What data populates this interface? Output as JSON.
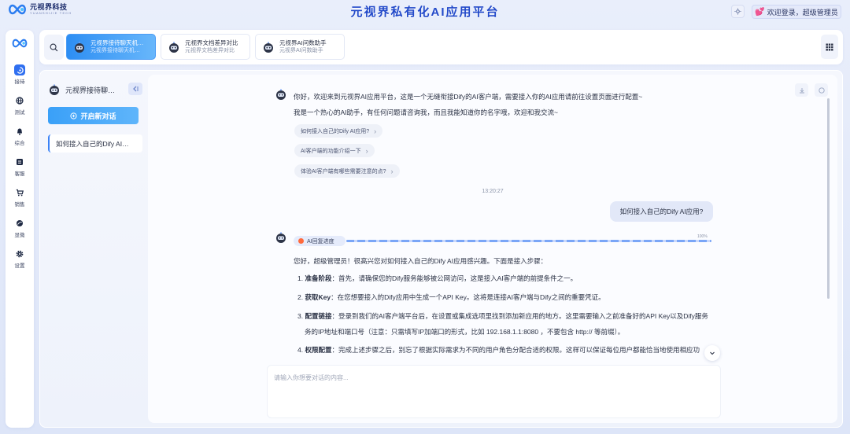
{
  "header": {
    "logo_cn": "元视界科技",
    "logo_en": "YUANSHIJIE TECH",
    "app_title": "元视界私有化AI应用平台",
    "user_greeting": "欢迎登录，超级管理员"
  },
  "rail": {
    "items": [
      {
        "label": "接待",
        "icon": "reception-icon",
        "active": true
      },
      {
        "label": "测试",
        "icon": "globe-icon",
        "active": false
      },
      {
        "label": "综合",
        "icon": "bell-icon",
        "active": false
      },
      {
        "label": "客服",
        "icon": "list-icon",
        "active": false
      },
      {
        "label": "销售",
        "icon": "cart-icon",
        "active": false
      },
      {
        "label": "显微",
        "icon": "planet-icon",
        "active": false
      },
      {
        "label": "设置",
        "icon": "gear-icon",
        "active": false
      }
    ]
  },
  "tabs": [
    {
      "title": "元视界接待聊天机…",
      "subtitle": "元视界接待聊天机…",
      "active": true
    },
    {
      "title": "元视界文档差异对比",
      "subtitle": "元视界文档差异对比",
      "active": false
    },
    {
      "title": "元视界AI问数助手",
      "subtitle": "元视界AI问数助手",
      "active": false
    }
  ],
  "sidebar": {
    "agent_name": "元视界接待聊…",
    "new_chat_label": "开启新对话",
    "conversations": [
      "如何接入自己的Dify AI…"
    ]
  },
  "chat": {
    "welcome_line1": "你好，欢迎来到元视界AI应用平台，这是一个无缝衔接Dify的AI客户端，需要接入你的AI应用请前往设置页面进行配置~",
    "welcome_line2": "我是一个热心的AI助手，有任何问题请咨询我，而且我能知道你的名字哦，欢迎和我交流~",
    "suggestions": [
      "如何接入自己的Dify AI应用?",
      "AI客户端的功能介绍一下",
      "体验AI客户端有哪些需要注意的点?"
    ],
    "timestamp": "13:20:27",
    "user_message": "如何接入自己的Dify AI应用?",
    "progress_label": "AI回复进度",
    "progress_percent": "100%",
    "progress_value": 1.0,
    "reply_intro": "您好，超级管理员！很高兴您对如何接入自己的Dify AI应用感兴趣。下面是接入步骤：",
    "steps": [
      {
        "num": "1.",
        "title": "准备阶段",
        "text": "：首先，请确保您的Dify服务能够被公网访问，这是接入AI客户端的前提条件之一。"
      },
      {
        "num": "2.",
        "title": "获取Key",
        "text": "：在您想要接入的Dify应用中生成一个API Key。这将是连接AI客户端与Dify之间的重要凭证。"
      },
      {
        "num": "3.",
        "title": "配置链接",
        "text": "：登录到我们的AI客户端平台后，在设置或集成选项里找到添加新应用的地方。这里需要输入之前准备好的API Key以及Dify服务",
        "cont_a": "务的IP地址和端口号（注意：只需填写IP加端口的形式，比如 ",
        "code_a": "192.168.1.1:8080",
        "cont_b": " ，不要包含 ",
        "code_b": "http://",
        "cont_c": " 等前缀）。"
      },
      {
        "num": "4.",
        "title": "权限配置",
        "text": "：完成上述步骤之后，别忘了根据实际需求为不同的用户角色分配合适的权限。这样可以保证每位用户都能恰当地使用相应功"
      }
    ],
    "composer_placeholder": "请输入你想要对话的内容..."
  }
}
